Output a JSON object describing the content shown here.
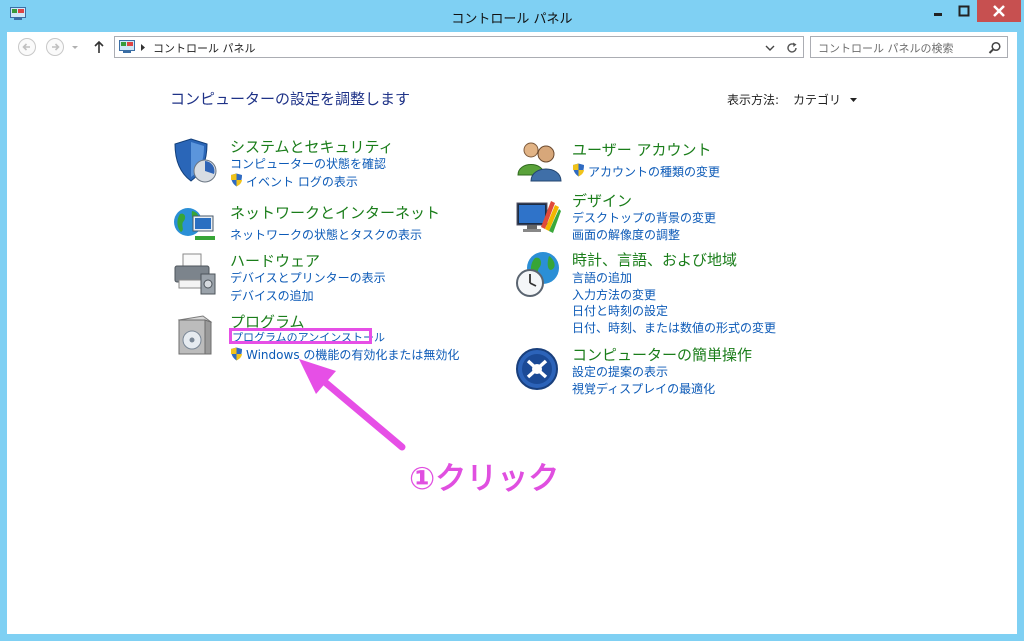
{
  "window": {
    "title": "コントロール パネル"
  },
  "address": {
    "path": "コントロール パネル"
  },
  "search": {
    "placeholder": "コントロール パネルの検索"
  },
  "main": {
    "heading": "コンピューターの設定を調整します",
    "view_by_label": "表示方法:",
    "view_by_value": "カテゴリ"
  },
  "categories": {
    "system": {
      "title": "システムとセキュリティ",
      "links": [
        "コンピューターの状態を確認",
        "イベント ログの表示"
      ]
    },
    "network": {
      "title": "ネットワークとインターネット",
      "links": [
        "ネットワークの状態とタスクの表示"
      ]
    },
    "hardware": {
      "title": "ハードウェア",
      "links": [
        "デバイスとプリンターの表示",
        "デバイスの追加"
      ]
    },
    "programs": {
      "title": "プログラム",
      "links": [
        "プログラムのアンインストール",
        "Windows の機能の有効化または無効化"
      ]
    },
    "user": {
      "title": "ユーザー アカウント",
      "links": [
        "アカウントの種類の変更"
      ]
    },
    "design": {
      "title": "デザイン",
      "links": [
        "デスクトップの背景の変更",
        "画面の解像度の調整"
      ]
    },
    "clock": {
      "title": "時計、言語、および地域",
      "links": [
        "言語の追加",
        "入力方法の変更",
        "日付と時刻の設定",
        "日付、時刻、または数値の形式の変更"
      ]
    },
    "ease": {
      "title": "コンピューターの簡単操作",
      "links": [
        "設定の提案の表示",
        "視覚ディスプレイの最適化"
      ]
    }
  },
  "annotation": {
    "text": "①クリック",
    "color": "#e04fe0"
  },
  "colors": {
    "frame": "#7fd0f3",
    "close": "#c75050",
    "link": "#0c5ab7",
    "category": "#1a7d1a",
    "heading": "#1e3287"
  }
}
